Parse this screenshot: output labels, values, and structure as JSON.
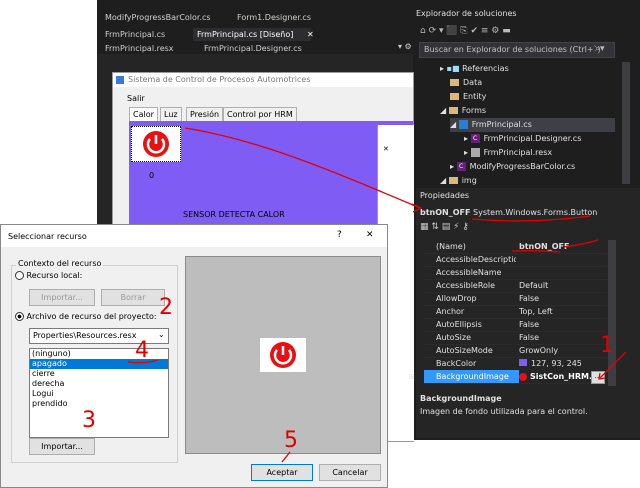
{
  "vs": {
    "tabs_row1": [
      "ModifyProgressBarColor.cs",
      "Form1.Designer.cs"
    ],
    "tabs_row2": [
      "FrmPrincipal.cs",
      "FrmPrincipal.cs [Diseño]",
      "FrmPrincipal.resx",
      "FrmPrincipal.Designer.cs"
    ],
    "tab_close": "✕",
    "form_title": "Sistema de Control de Procesos Automotrices",
    "form_menu": "Salir",
    "form_tabs": [
      "Calor",
      "Luz",
      "Presión",
      "Control por HRM"
    ],
    "counter_label": "0",
    "sensor_label": "SENSOR DETECTA CALOR"
  },
  "solution_explorer": {
    "title": "Explorador de soluciones",
    "search_placeholder": "Buscar en Explorador de soluciones (Ctrl+`)",
    "items": [
      {
        "label": "Referencias",
        "icon": "references-icon",
        "indent": 1
      },
      {
        "label": "Data",
        "icon": "folder-icon",
        "indent": 1
      },
      {
        "label": "Entity",
        "icon": "folder-icon",
        "indent": 1
      },
      {
        "label": "Forms",
        "icon": "folder-icon",
        "indent": 1
      },
      {
        "label": "FrmPrincipal.cs",
        "icon": "form-icon",
        "indent": 2
      },
      {
        "label": "FrmPrincipal.Designer.cs",
        "icon": "csharp-icon",
        "indent": 3
      },
      {
        "label": "FrmPrincipal.resx",
        "icon": "resx-icon",
        "indent": 3
      },
      {
        "label": "ModifyProgressBarColor.cs",
        "icon": "csharp-icon",
        "indent": 2
      },
      {
        "label": "img",
        "icon": "folder-icon",
        "indent": 1
      }
    ]
  },
  "properties": {
    "title": "Propiedades",
    "object_name": "btnON_OFF",
    "object_type": "System.Windows.Forms.Button",
    "rows": [
      {
        "name": "(Name)",
        "value": "btnON_OFF"
      },
      {
        "name": "AccessibleDescription",
        "value": ""
      },
      {
        "name": "AccessibleName",
        "value": ""
      },
      {
        "name": "AccessibleRole",
        "value": "Default"
      },
      {
        "name": "AllowDrop",
        "value": "False"
      },
      {
        "name": "Anchor",
        "value": "Top, Left"
      },
      {
        "name": "AutoEllipsis",
        "value": "False"
      },
      {
        "name": "AutoSize",
        "value": "False"
      },
      {
        "name": "AutoSizeMode",
        "value": "GrowOnly"
      },
      {
        "name": "BackColor",
        "value": "127, 93, 245"
      },
      {
        "name": "BackgroundImage",
        "value": "SistCon_HRM.P"
      }
    ],
    "backcolor_swatch": "#7f5df5",
    "desc_title": "BackgroundImage",
    "desc_text": "Imagen de fondo utilizada para el control.",
    "ellipsis": "..."
  },
  "dialog": {
    "title": "Seleccionar recurso",
    "help": "?",
    "close": "✕",
    "group_label": "Contexto del recurso",
    "radio_local": "Recurso local:",
    "import_local": "Importar...",
    "clear_local": "Borrar",
    "radio_project": "Archivo de recurso del proyecto:",
    "resource_file": "Properties\\Resources.resx",
    "list": [
      "(ninguno)",
      "apagado",
      "cierre",
      "derecha",
      "Logui",
      "prendido"
    ],
    "selected_index": 1,
    "import_button": "Importar...",
    "accept_button": "Aceptar",
    "cancel_button": "Cancelar"
  },
  "annotations": [
    "1",
    "2",
    "3",
    "4",
    "5"
  ],
  "colors": {
    "vs_dark": "#1e1e1e",
    "form_purple": "#7f5df5",
    "power_red": "#e81010",
    "selection": "#0078d7",
    "annotation_red": "#e00000"
  }
}
